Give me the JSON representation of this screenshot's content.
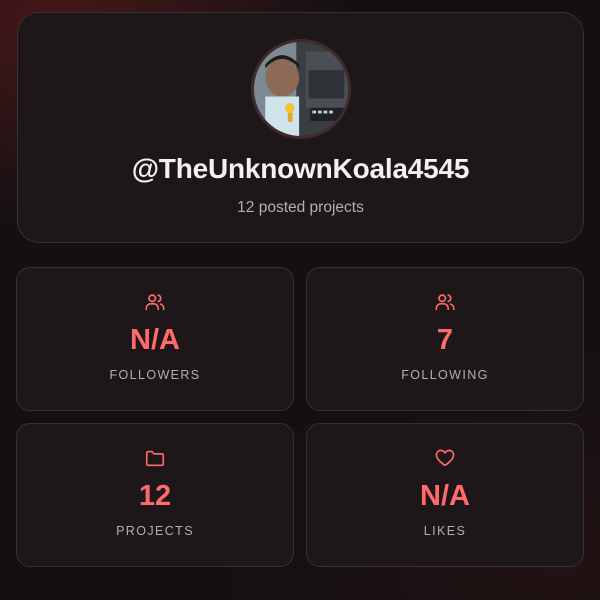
{
  "profile": {
    "username": "@TheUnknownKoala4545",
    "subtitle": "12 posted projects"
  },
  "stats": [
    {
      "value": "N/A",
      "label": "FOLLOWERS",
      "icon": "users-icon"
    },
    {
      "value": "7",
      "label": "FOLLOWING",
      "icon": "users-icon"
    },
    {
      "value": "12",
      "label": "PROJECTS",
      "icon": "folder-icon"
    },
    {
      "value": "N/A",
      "label": "LIKES",
      "icon": "heart-icon"
    }
  ],
  "colors": {
    "accent": "#ff6b6b",
    "card_background": "#1d1719",
    "page_background": "#141012",
    "muted_text": "#b7adaf"
  }
}
